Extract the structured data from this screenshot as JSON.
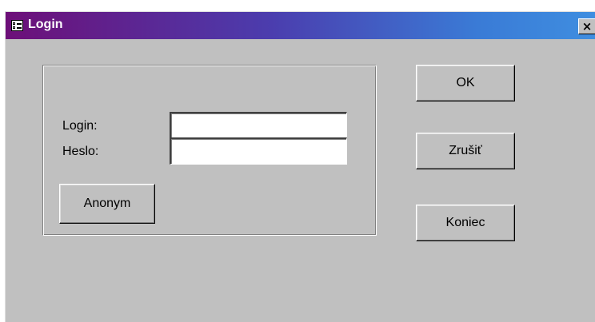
{
  "window": {
    "title": "Login",
    "icon": "form-icon",
    "close_label": "×"
  },
  "form": {
    "login_label": "Login:",
    "login_value": "",
    "password_label": "Heslo:",
    "password_value": "",
    "anonym_label": "Anonym"
  },
  "buttons": {
    "ok_label": "OK",
    "cancel_label": "Zrušiť",
    "exit_label": "Koniec"
  },
  "colors": {
    "titlebar_start": "#6d0f78",
    "titlebar_end": "#3f8ee0",
    "dialog_bg": "#c0c0c0"
  }
}
